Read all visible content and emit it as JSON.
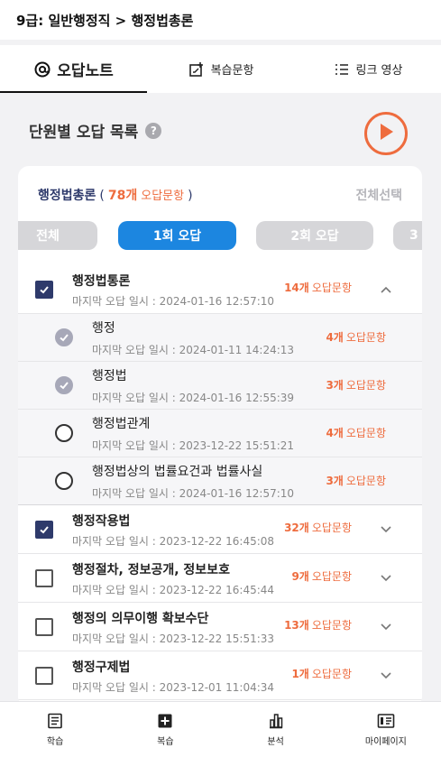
{
  "breadcrumb": "9급: 일반행정직 > 행정법총론",
  "tabs": [
    {
      "label": "오답노트",
      "icon": "at-sign-icon",
      "active": true
    },
    {
      "label": "복습문항",
      "icon": "edit-plus-icon",
      "active": false
    },
    {
      "label": "링크 영상",
      "icon": "list-icon",
      "active": false
    }
  ],
  "section": {
    "title": "단원별 오답 목록",
    "help_glyph": "?"
  },
  "card": {
    "subject": "행정법총론",
    "paren_open": "(",
    "count": "78개",
    "count_suffix": "오답문항",
    "paren_close": ")",
    "select_all": "전체선택"
  },
  "filters": [
    "전체",
    "1회 오답",
    "2회 오답",
    "3"
  ],
  "active_filter": "1회 오답",
  "wrong_suffix": "오답문항",
  "date_label": "마지막 오답 일시 : ",
  "rows": [
    {
      "kind": "group",
      "title": "행정법통론",
      "date": "마지막 오답 일시 : 2024-01-16 12:57:10",
      "count": "14개",
      "checked": true,
      "expanded": true
    },
    {
      "kind": "sub",
      "title": "행정",
      "date": "마지막 오답 일시 : 2024-01-11 14:24:13",
      "count": "4개",
      "checked": true
    },
    {
      "kind": "sub",
      "title": "행정법",
      "date": "마지막 오답 일시 : 2024-01-16 12:55:39",
      "count": "3개",
      "checked": true
    },
    {
      "kind": "sub",
      "title": "행정법관계",
      "date": "마지막 오답 일시 : 2023-12-22 15:51:21",
      "count": "4개",
      "checked": false
    },
    {
      "kind": "sub",
      "title": "행정법상의 법률요건과 법률사실",
      "date": "마지막 오답 일시 : 2024-01-16 12:57:10",
      "count": "3개",
      "checked": false
    },
    {
      "kind": "group",
      "title": "행정작용법",
      "date": "마지막 오답 일시 : 2023-12-22 16:45:08",
      "count": "32개",
      "checked": true,
      "expanded": false
    },
    {
      "kind": "group",
      "title": "행정절차, 정보공개, 정보보호",
      "date": "마지막 오답 일시 : 2023-12-22 16:45:44",
      "count": "9개",
      "checked": false,
      "expanded": false
    },
    {
      "kind": "group",
      "title": "행정의 의무이행 확보수단",
      "date": "마지막 오답 일시 : 2023-12-22 15:51:33",
      "count": "13개",
      "checked": false,
      "expanded": false
    },
    {
      "kind": "group",
      "title": "행정구제법",
      "date": "마지막 오답 일시 : 2023-12-01 11:04:34",
      "count": "1개",
      "checked": false,
      "expanded": false
    }
  ],
  "bottom_nav": [
    {
      "label": "학습",
      "icon": "book-icon"
    },
    {
      "label": "복습",
      "icon": "plus-box-icon"
    },
    {
      "label": "분석",
      "icon": "bar-chart-icon"
    },
    {
      "label": "마이페이지",
      "icon": "id-card-icon"
    }
  ],
  "colors": {
    "accent": "#1c86e0",
    "orange": "#ee6c3e",
    "navy": "#2e3a6b"
  }
}
